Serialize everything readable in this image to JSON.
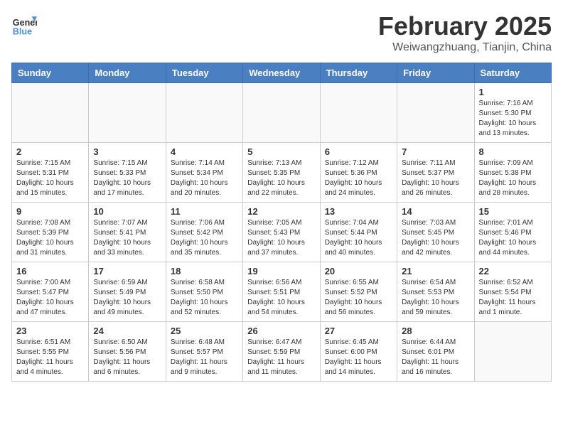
{
  "header": {
    "logo_line1": "General",
    "logo_line2": "Blue",
    "month": "February 2025",
    "location": "Weiwangzhuang, Tianjin, China"
  },
  "days_of_week": [
    "Sunday",
    "Monday",
    "Tuesday",
    "Wednesday",
    "Thursday",
    "Friday",
    "Saturday"
  ],
  "weeks": [
    [
      {
        "day": "",
        "info": ""
      },
      {
        "day": "",
        "info": ""
      },
      {
        "day": "",
        "info": ""
      },
      {
        "day": "",
        "info": ""
      },
      {
        "day": "",
        "info": ""
      },
      {
        "day": "",
        "info": ""
      },
      {
        "day": "1",
        "info": "Sunrise: 7:16 AM\nSunset: 5:30 PM\nDaylight: 10 hours\nand 13 minutes."
      }
    ],
    [
      {
        "day": "2",
        "info": "Sunrise: 7:15 AM\nSunset: 5:31 PM\nDaylight: 10 hours\nand 15 minutes."
      },
      {
        "day": "3",
        "info": "Sunrise: 7:15 AM\nSunset: 5:33 PM\nDaylight: 10 hours\nand 17 minutes."
      },
      {
        "day": "4",
        "info": "Sunrise: 7:14 AM\nSunset: 5:34 PM\nDaylight: 10 hours\nand 20 minutes."
      },
      {
        "day": "5",
        "info": "Sunrise: 7:13 AM\nSunset: 5:35 PM\nDaylight: 10 hours\nand 22 minutes."
      },
      {
        "day": "6",
        "info": "Sunrise: 7:12 AM\nSunset: 5:36 PM\nDaylight: 10 hours\nand 24 minutes."
      },
      {
        "day": "7",
        "info": "Sunrise: 7:11 AM\nSunset: 5:37 PM\nDaylight: 10 hours\nand 26 minutes."
      },
      {
        "day": "8",
        "info": "Sunrise: 7:09 AM\nSunset: 5:38 PM\nDaylight: 10 hours\nand 28 minutes."
      }
    ],
    [
      {
        "day": "9",
        "info": "Sunrise: 7:08 AM\nSunset: 5:39 PM\nDaylight: 10 hours\nand 31 minutes."
      },
      {
        "day": "10",
        "info": "Sunrise: 7:07 AM\nSunset: 5:41 PM\nDaylight: 10 hours\nand 33 minutes."
      },
      {
        "day": "11",
        "info": "Sunrise: 7:06 AM\nSunset: 5:42 PM\nDaylight: 10 hours\nand 35 minutes."
      },
      {
        "day": "12",
        "info": "Sunrise: 7:05 AM\nSunset: 5:43 PM\nDaylight: 10 hours\nand 37 minutes."
      },
      {
        "day": "13",
        "info": "Sunrise: 7:04 AM\nSunset: 5:44 PM\nDaylight: 10 hours\nand 40 minutes."
      },
      {
        "day": "14",
        "info": "Sunrise: 7:03 AM\nSunset: 5:45 PM\nDaylight: 10 hours\nand 42 minutes."
      },
      {
        "day": "15",
        "info": "Sunrise: 7:01 AM\nSunset: 5:46 PM\nDaylight: 10 hours\nand 44 minutes."
      }
    ],
    [
      {
        "day": "16",
        "info": "Sunrise: 7:00 AM\nSunset: 5:47 PM\nDaylight: 10 hours\nand 47 minutes."
      },
      {
        "day": "17",
        "info": "Sunrise: 6:59 AM\nSunset: 5:49 PM\nDaylight: 10 hours\nand 49 minutes."
      },
      {
        "day": "18",
        "info": "Sunrise: 6:58 AM\nSunset: 5:50 PM\nDaylight: 10 hours\nand 52 minutes."
      },
      {
        "day": "19",
        "info": "Sunrise: 6:56 AM\nSunset: 5:51 PM\nDaylight: 10 hours\nand 54 minutes."
      },
      {
        "day": "20",
        "info": "Sunrise: 6:55 AM\nSunset: 5:52 PM\nDaylight: 10 hours\nand 56 minutes."
      },
      {
        "day": "21",
        "info": "Sunrise: 6:54 AM\nSunset: 5:53 PM\nDaylight: 10 hours\nand 59 minutes."
      },
      {
        "day": "22",
        "info": "Sunrise: 6:52 AM\nSunset: 5:54 PM\nDaylight: 11 hours\nand 1 minute."
      }
    ],
    [
      {
        "day": "23",
        "info": "Sunrise: 6:51 AM\nSunset: 5:55 PM\nDaylight: 11 hours\nand 4 minutes."
      },
      {
        "day": "24",
        "info": "Sunrise: 6:50 AM\nSunset: 5:56 PM\nDaylight: 11 hours\nand 6 minutes."
      },
      {
        "day": "25",
        "info": "Sunrise: 6:48 AM\nSunset: 5:57 PM\nDaylight: 11 hours\nand 9 minutes."
      },
      {
        "day": "26",
        "info": "Sunrise: 6:47 AM\nSunset: 5:59 PM\nDaylight: 11 hours\nand 11 minutes."
      },
      {
        "day": "27",
        "info": "Sunrise: 6:45 AM\nSunset: 6:00 PM\nDaylight: 11 hours\nand 14 minutes."
      },
      {
        "day": "28",
        "info": "Sunrise: 6:44 AM\nSunset: 6:01 PM\nDaylight: 11 hours\nand 16 minutes."
      },
      {
        "day": "",
        "info": ""
      }
    ]
  ]
}
